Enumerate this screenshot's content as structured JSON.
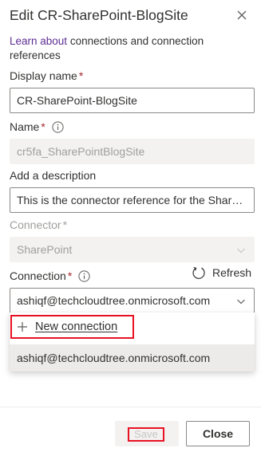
{
  "panel": {
    "title": "Edit CR-SharePoint-BlogSite",
    "learn_link": "Learn about",
    "learn_text": " connections and connection references"
  },
  "display_name": {
    "label": "Display name",
    "required": "*",
    "value": "CR-SharePoint-BlogSite"
  },
  "name": {
    "label": "Name",
    "required": "*",
    "value": "cr5fa_SharePointBlogSite"
  },
  "description": {
    "label": "Add a description",
    "value": "This is the connector reference for the SharePoint..."
  },
  "connector": {
    "label": "Connector",
    "required": "*",
    "value": "SharePoint"
  },
  "connection": {
    "label": "Connection",
    "required": "*",
    "value": "ashiqf@techcloudtree.onmicrosoft.com",
    "refresh_label": "Refresh",
    "dropdown": {
      "new_connection_label": "New connection",
      "options": [
        "ashiqf@techcloudtree.onmicrosoft.com"
      ]
    }
  },
  "footer": {
    "save_label": "Save",
    "close_label": "Close"
  },
  "colors": {
    "link": "#5c2d91",
    "required": "#a4262c",
    "highlight": "#e81123"
  }
}
